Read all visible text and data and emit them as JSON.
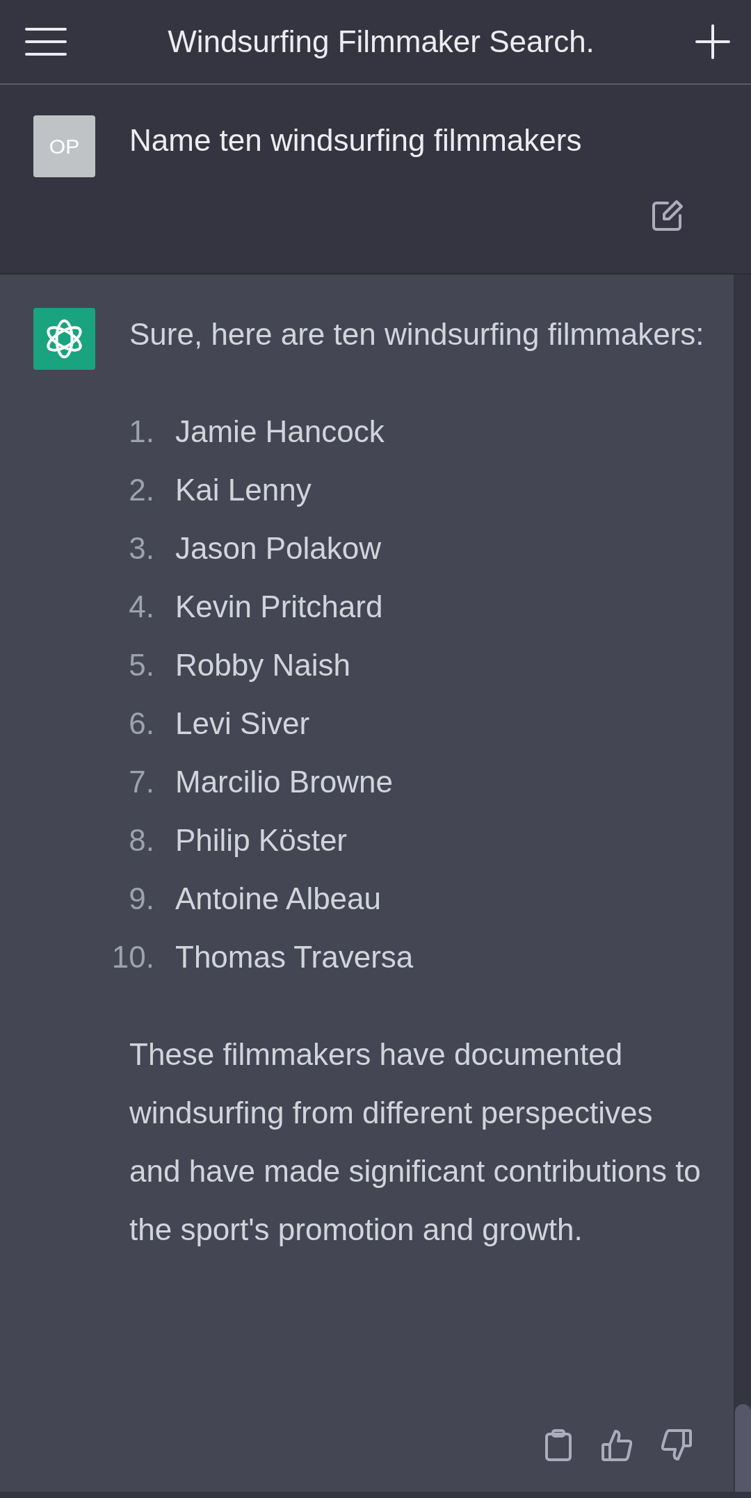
{
  "header": {
    "title": "Windsurfing Filmmaker Search."
  },
  "user_message": {
    "avatar": "OP",
    "text": "Name ten windsurfing filmmakers"
  },
  "assistant_message": {
    "intro": "Sure, here are ten windsurfing filmmakers:",
    "list": [
      {
        "number": "1.",
        "name": "Jamie Hancock"
      },
      {
        "number": "2.",
        "name": "Kai Lenny"
      },
      {
        "number": "3.",
        "name": "Jason Polakow"
      },
      {
        "number": "4.",
        "name": "Kevin Pritchard"
      },
      {
        "number": "5.",
        "name": "Robby Naish"
      },
      {
        "number": "6.",
        "name": "Levi Siver"
      },
      {
        "number": "7.",
        "name": "Marcilio Browne"
      },
      {
        "number": "8.",
        "name": "Philip Köster"
      },
      {
        "number": "9.",
        "name": "Antoine Albeau"
      },
      {
        "number": "10.",
        "name": "Thomas Traversa"
      }
    ],
    "closing": "These filmmakers have documented windsurfing from different perspectives and have made significant contributions to the sport's promotion and growth."
  }
}
